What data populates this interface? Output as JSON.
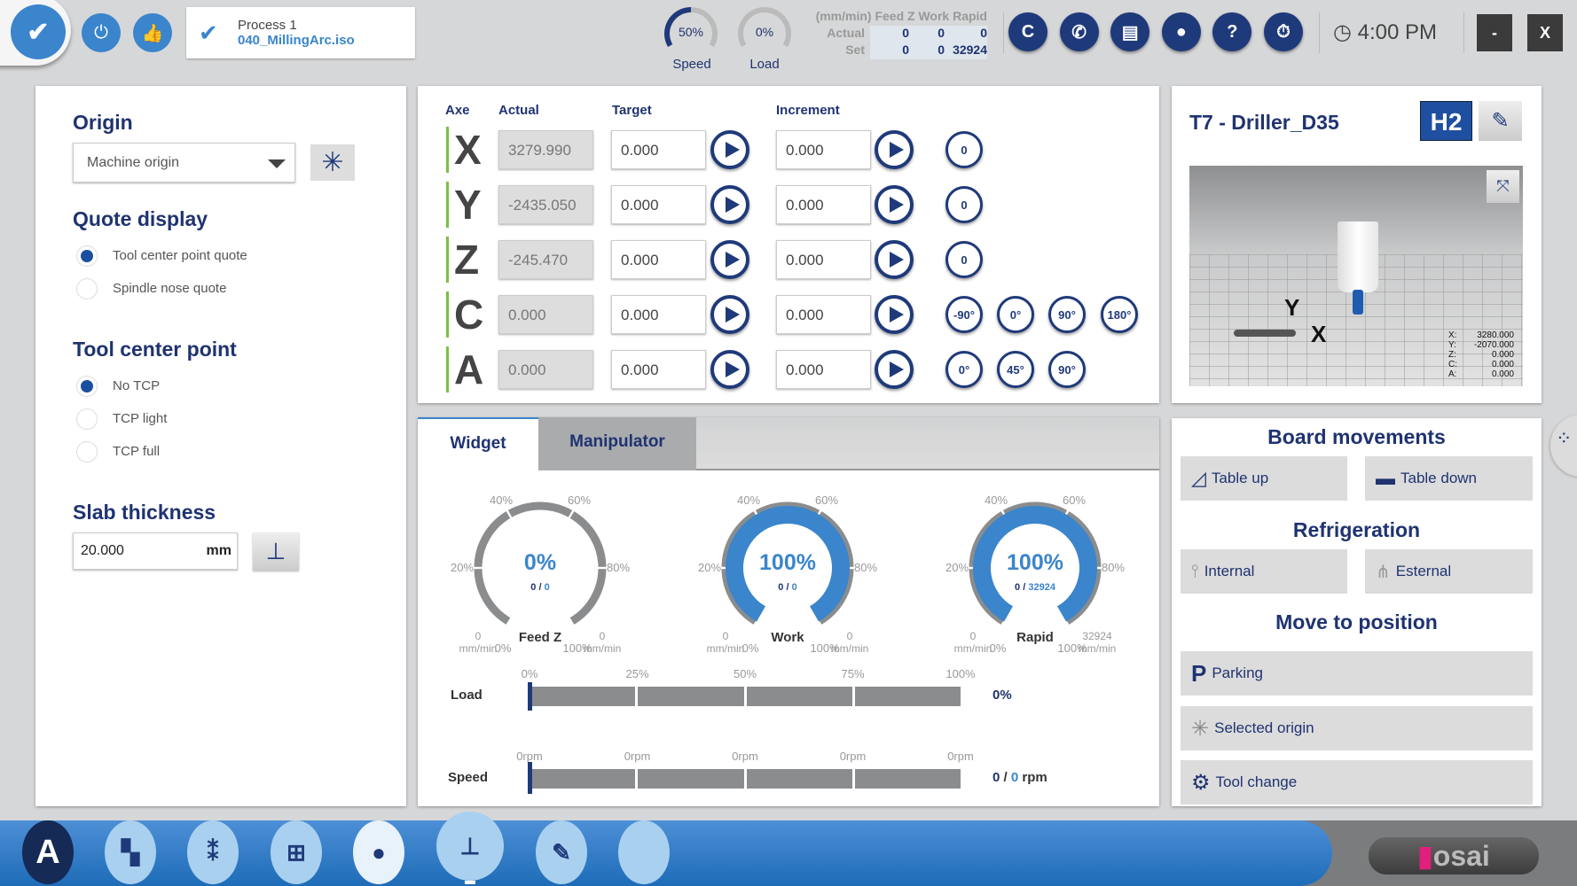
{
  "topbar": {
    "process_name": "Process 1",
    "process_file": "040_MillingArc.iso",
    "speed": {
      "label": "Speed",
      "value": "50%",
      "fraction": 0.5
    },
    "load": {
      "label": "Load",
      "value": "0%",
      "fraction": 0
    },
    "feed_table": {
      "header": "(mm/min) Feed Z Work Rapid",
      "rows": [
        {
          "label": "Actual",
          "values": [
            "0",
            "0",
            "0"
          ]
        },
        {
          "label": "Set",
          "values": [
            "0",
            "0",
            "32924"
          ]
        }
      ]
    },
    "icons": [
      "c-icon",
      "phone-icon",
      "printer-icon",
      "user-icon",
      "help-icon",
      "timer-icon"
    ],
    "icon_glyphs": [
      "C",
      "✆",
      "▤",
      "●",
      "?",
      "⏱"
    ],
    "clock": "4:00 PM",
    "minimize": "-",
    "close": "X"
  },
  "left": {
    "origin_title": "Origin",
    "origin_value": "Machine origin",
    "quote_title": "Quote display",
    "quote_options": [
      "Tool center point quote",
      "Spindle nose quote"
    ],
    "quote_selected": 0,
    "tcp_title": "Tool center point",
    "tcp_options": [
      "No TCP",
      "TCP light",
      "TCP full"
    ],
    "tcp_selected": 0,
    "slab_title": "Slab thickness",
    "slab_value": "20.000",
    "slab_unit": "mm"
  },
  "axes": {
    "headers": {
      "axe": "Axe",
      "actual": "Actual",
      "target": "Target",
      "increment": "Increment"
    },
    "rows": [
      {
        "axis": "X",
        "actual": "3279.990",
        "target": "0.000",
        "increment": "0.000",
        "presets": [
          "0"
        ]
      },
      {
        "axis": "Y",
        "actual": "-2435.050",
        "target": "0.000",
        "increment": "0.000",
        "presets": [
          "0"
        ]
      },
      {
        "axis": "Z",
        "actual": "-245.470",
        "target": "0.000",
        "increment": "0.000",
        "presets": [
          "0"
        ]
      },
      {
        "axis": "C",
        "actual": "0.000",
        "target": "0.000",
        "increment": "0.000",
        "presets": [
          "-90°",
          "0°",
          "90°",
          "180°"
        ]
      },
      {
        "axis": "A",
        "actual": "0.000",
        "target": "0.000",
        "increment": "0.000",
        "presets": [
          "0°",
          "45°",
          "90°"
        ]
      }
    ]
  },
  "tool": {
    "title": "T7 - Driller_D35",
    "head": "H2",
    "axis_y": "Y",
    "axis_x": "X",
    "coords": [
      {
        "k": "X:",
        "v": "3280.000"
      },
      {
        "k": "Y:",
        "v": "-2070.000"
      },
      {
        "k": "Z:",
        "v": "0.000"
      },
      {
        "k": "C:",
        "v": "0.000"
      },
      {
        "k": "A:",
        "v": "0.000"
      }
    ]
  },
  "tabs": [
    {
      "label": "Widget",
      "active": true
    },
    {
      "label": "Manipulator",
      "active": false
    }
  ],
  "gauges": [
    {
      "name": "Feed Z",
      "percent": "0%",
      "fraction": 0,
      "actual": "0",
      "set": "0",
      "min": "0",
      "max": "0",
      "unit": "mm/min"
    },
    {
      "name": "Work",
      "percent": "100%",
      "fraction": 1,
      "actual": "0",
      "set": "0",
      "min": "0",
      "max": "0",
      "unit": "mm/min"
    },
    {
      "name": "Rapid",
      "percent": "100%",
      "fraction": 1,
      "actual": "0",
      "set": "32924",
      "min": "0",
      "max": "32924",
      "unit": "mm/min"
    }
  ],
  "gauge_ticks": [
    "0%",
    "20%",
    "40%",
    "60%",
    "80%",
    "100%"
  ],
  "load_bar": {
    "label": "Load",
    "ticks": [
      "0%",
      "25%",
      "50%",
      "75%",
      "100%"
    ],
    "value": "0%",
    "fraction": 0
  },
  "speed_bar": {
    "label": "Speed",
    "ticks": [
      "0rpm",
      "0rpm",
      "0rpm",
      "0rpm",
      "0rpm"
    ],
    "actual": "0",
    "sep": " / ",
    "set": "0",
    "unit": " rpm",
    "fraction": 0
  },
  "right": {
    "board_title": "Board movements",
    "table_up": "Table up",
    "table_down": "Table down",
    "refrig_title": "Refrigeration",
    "internal": "Internal",
    "esternal": "Esternal",
    "move_title": "Move to position",
    "parking": "Parking",
    "parking_glyph": "P",
    "selected_origin": "Selected origin",
    "tool_change": "Tool change"
  },
  "bottombar": {
    "app_letter": "A",
    "logo": "osai"
  },
  "colors": {
    "navy": "#1f3a7a",
    "blue": "#3a85cc",
    "gray": "#8a8c8e",
    "green": "#7ac143"
  }
}
